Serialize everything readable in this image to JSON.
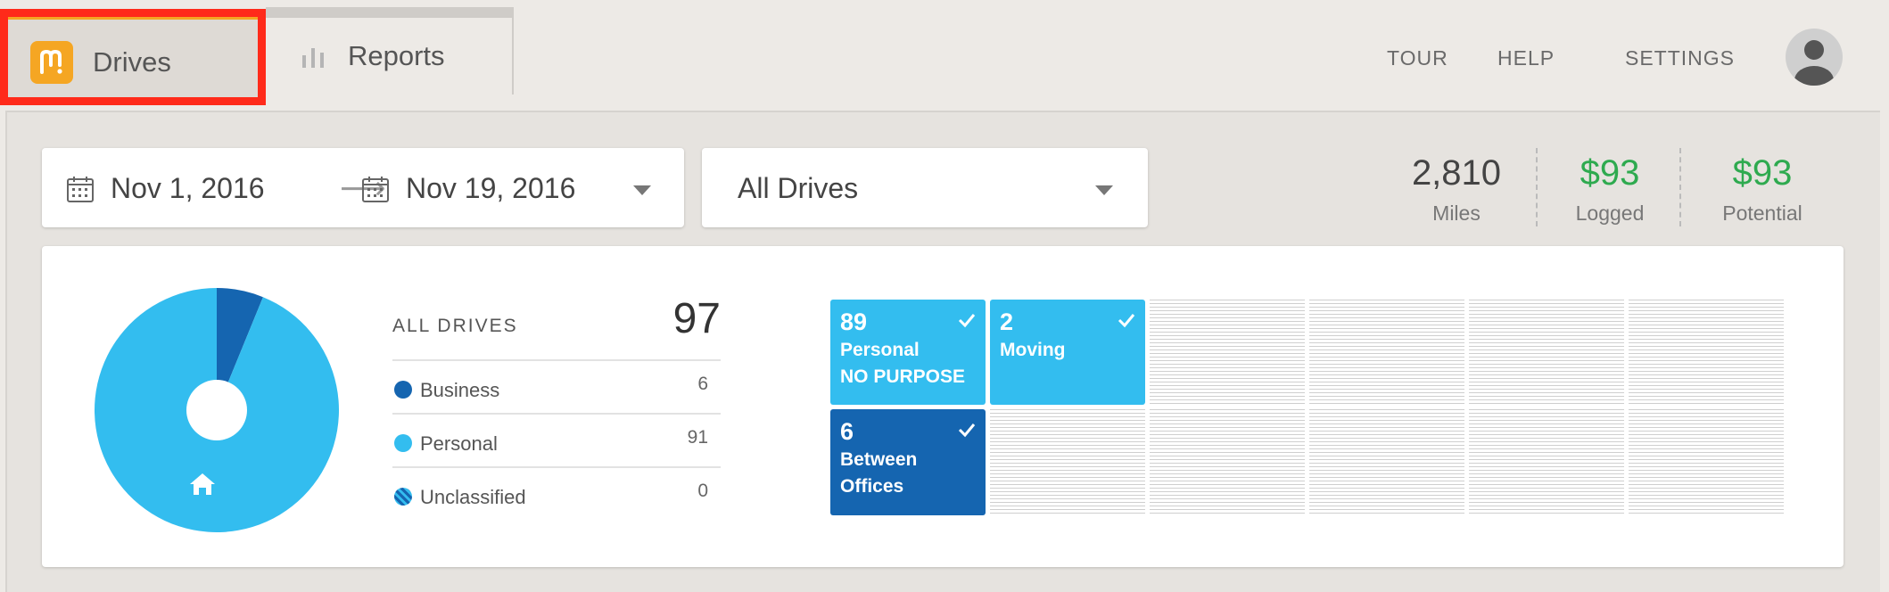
{
  "nav": {
    "tabs": [
      {
        "label": "Drives",
        "icon": "mileiq-logo-icon",
        "active": true
      },
      {
        "label": "Reports",
        "icon": "bar-chart-icon",
        "active": false
      }
    ],
    "links": [
      "TOUR",
      "HELP",
      "SETTINGS"
    ],
    "avatar_icon": "user-avatar-icon"
  },
  "filters": {
    "start_date": "Nov 1, 2016",
    "arrow": "⟶",
    "end_date": "Nov 19, 2016",
    "drive_filter": "All Drives"
  },
  "stats": [
    {
      "value": "2,810",
      "label": "Miles",
      "color": "#444444"
    },
    {
      "value": "$93",
      "label": "Logged",
      "color": "#2eaa4f"
    },
    {
      "value": "$93",
      "label": "Potential",
      "color": "#2eaa4f"
    }
  ],
  "summary": {
    "title": "ALL DRIVES",
    "total": "97",
    "categories": [
      {
        "name": "Business",
        "count": "6",
        "color": "#1565b0"
      },
      {
        "name": "Personal",
        "count": "91",
        "color": "#33bdef"
      },
      {
        "name": "Unclassified",
        "count": "0",
        "color": "striped"
      }
    ],
    "pie": {
      "business": 6,
      "personal": 91,
      "unclassified": 0,
      "center_icon": "home-icon"
    }
  },
  "tiles": [
    {
      "count": "89",
      "line1": "Personal",
      "line2": "NO PURPOSE",
      "color": "#33bdef",
      "checked": true
    },
    {
      "count": "2",
      "line1": "Moving",
      "line2": "",
      "color": "#33bdef",
      "checked": true
    },
    {
      "count": "6",
      "line1": "Between",
      "line2": "Offices",
      "color": "#1565b0",
      "checked": true
    }
  ],
  "colors": {
    "accent": "#f5a623",
    "highlight": "#ff2a1a",
    "business": "#1565b0",
    "personal": "#33bdef",
    "money": "#2eaa4f"
  }
}
